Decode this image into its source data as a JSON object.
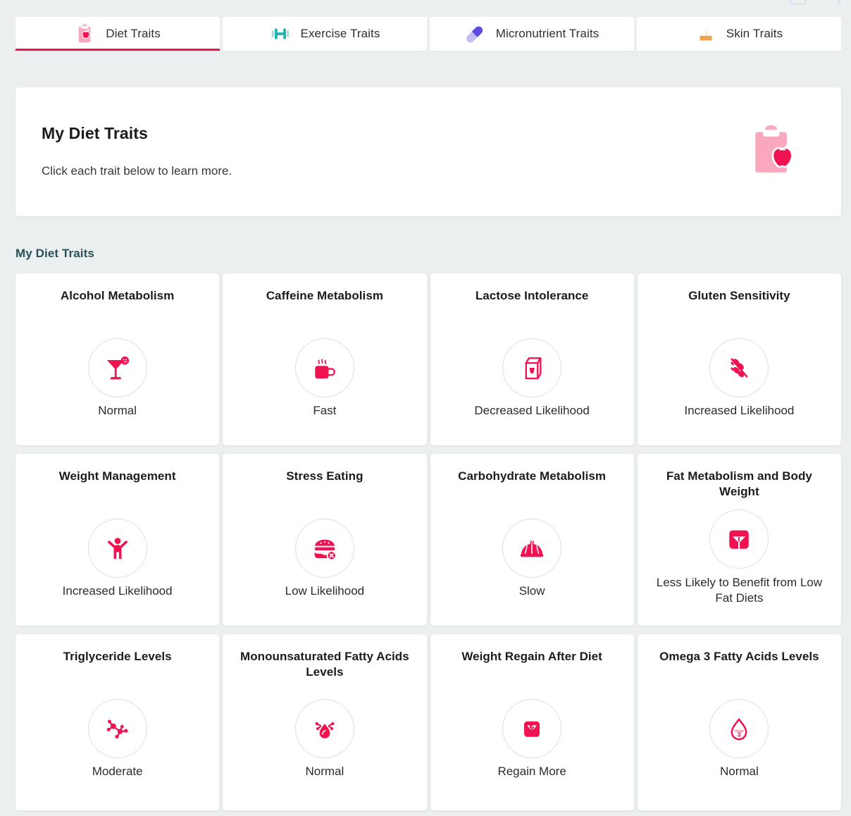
{
  "tabs": [
    {
      "label": "Diet Traits",
      "icon": "clipboard-apple-icon",
      "active": true
    },
    {
      "label": "Exercise Traits",
      "icon": "dumbbell-icon",
      "active": false
    },
    {
      "label": "Micronutrient Traits",
      "icon": "pill-capsule-icon",
      "active": false
    },
    {
      "label": "Skin Traits",
      "icon": "skin-follicle-icon",
      "active": false
    }
  ],
  "hero": {
    "title": "My Diet Traits",
    "subtitle": "Click each trait below to learn more.",
    "icon": "clipboard-apple-icon"
  },
  "section": {
    "title": "My Diet Traits"
  },
  "colors": {
    "accent": "#ef1352",
    "accent_light": "#f9a8be",
    "teal": "#1fb2b2",
    "purple": "#5b4be0",
    "purple_light": "#c3bdf4",
    "orange": "#eda34a",
    "section_title": "#2b5157",
    "page_bg": "#eceff0",
    "card_bg": "#ffffff"
  },
  "traits": [
    {
      "name": "Alcohol Metabolism",
      "value": "Normal",
      "icon": "cocktail-glass-icon"
    },
    {
      "name": "Caffeine Metabolism",
      "value": "Fast",
      "icon": "coffee-mug-icon"
    },
    {
      "name": "Lactose Intolerance",
      "value": "Decreased Likelihood",
      "icon": "milk-carton-icon"
    },
    {
      "name": "Gluten Sensitivity",
      "value": "Increased Likelihood",
      "icon": "wheat-stalk-icon"
    },
    {
      "name": "Weight Management",
      "value": "Increased Likelihood",
      "icon": "person-arms-up-icon"
    },
    {
      "name": "Stress Eating",
      "value": "Low Likelihood",
      "icon": "burger-no-icon"
    },
    {
      "name": "Carbohydrate Metabolism",
      "value": "Slow",
      "icon": "bread-bun-icon"
    },
    {
      "name": "Fat Metabolism and Body Weight",
      "value": "Less Likely to Benefit from Low Fat Diets",
      "icon": "weight-scale-icon"
    },
    {
      "name": "Triglyceride Levels",
      "value": "Moderate",
      "icon": "molecule-icon"
    },
    {
      "name": "Monounsaturated Fatty Acids Levels",
      "value": "Normal",
      "icon": "droplet-molecule-icon"
    },
    {
      "name": "Weight Regain After Diet",
      "value": "Regain More",
      "icon": "weight-scale-filled-icon"
    },
    {
      "name": "Omega 3 Fatty Acids Levels",
      "value": "Normal",
      "icon": "omega3-droplet-icon"
    }
  ]
}
